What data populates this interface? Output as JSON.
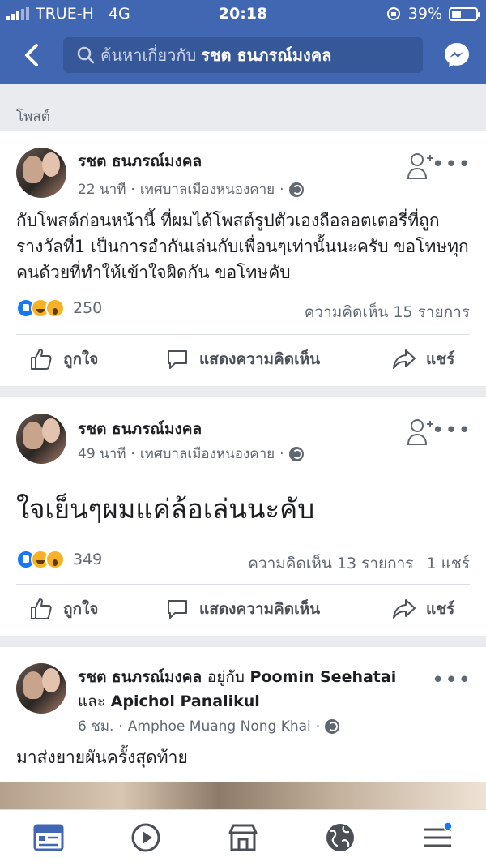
{
  "status_bar": {
    "carrier": "TRUE-H",
    "network": "4G",
    "time": "20:18",
    "battery": "39%",
    "battery_level": 0.39
  },
  "search": {
    "prefix": "ค้นหาเกี่ยวกับ",
    "query": "รชต ธนภรณ์มงคล"
  },
  "section_label": "โพสต์",
  "posts": [
    {
      "author": "รชต ธนภรณ์มงคล",
      "time": "22 นาที",
      "location": "เทศบาลเมืองหนองคาย",
      "text": "กับโพสต์ก่อนหน้านี้ ที่ผมได้โพสต์รูปตัวเองถือลอตเตอรี่ที่ถูกรางวัลที่1 เป็นการอำกันเล่นกับเพื่อนๆเท่านั้นนะครับ ขอโทษทุกคนด้วยที่ทำให้เข้าใจผิดกัน  ขอโทษคับ",
      "reactions": "250",
      "comments": "ความคิดเห็น 15 รายการ",
      "shares": ""
    },
    {
      "author": "รชต ธนภรณ์มงคล",
      "time": "49 นาที",
      "location": "เทศบาลเมืองหนองคาย",
      "text": "ใจเย็นๆผมแค่ล้อเล่นนะคับ",
      "reactions": "349",
      "comments": "ความคิดเห็น 13 รายการ",
      "shares": "1 แชร์"
    },
    {
      "author": "รชต ธนภรณ์มงคล",
      "with_word": "อยู่กับ",
      "tagged1": "Poomin Seehatai",
      "and_word": "และ",
      "tagged2": "Apichol Panalikul",
      "time": "6 ชม.",
      "location": "Amphoe Muang Nong Khai",
      "text": "มาส่งยายผันครั้งสุดท้าย"
    }
  ],
  "actions": {
    "like": "ถูกใจ",
    "comment": "แสดงความคิดเห็น",
    "share": "แชร์"
  },
  "colors": {
    "facebook_blue": "#4267b2",
    "search_bg": "#365899",
    "like_blue": "#1877f2",
    "tab_active": "#4267b2"
  }
}
